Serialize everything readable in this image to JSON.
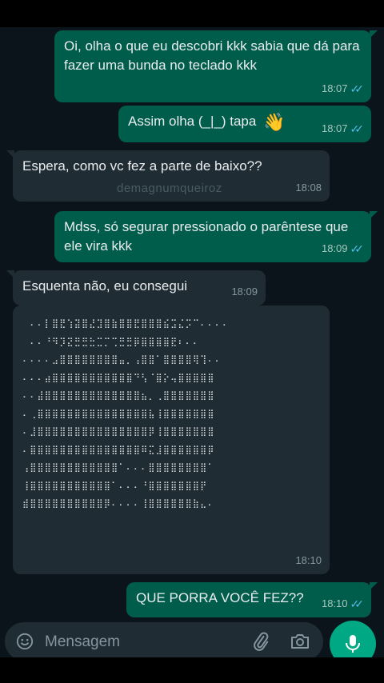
{
  "messages": [
    {
      "id": "m1",
      "direction": "out",
      "text": "Oi, olha o que eu descobri kkk sabia que dá para fazer uma bunda no teclado kkk",
      "time": "18:07",
      "status": "read"
    },
    {
      "id": "m2",
      "direction": "out",
      "text": "Assim olha (_|_) tapa",
      "emoji": "👋",
      "time": "18:07",
      "status": "read"
    },
    {
      "id": "m3",
      "direction": "in",
      "text": "Espera, como vc fez a parte de baixo??",
      "time": "18:08",
      "watermark": "demagnumqueiroz"
    },
    {
      "id": "m4",
      "direction": "out",
      "text": "Mdss, só segurar pressionado o parêntese que ele vira kkk",
      "time": "18:09",
      "status": "read"
    },
    {
      "id": "m5",
      "direction": "in",
      "text": "Esquenta não, eu consegui",
      "time": "18:09"
    },
    {
      "id": "m6",
      "direction": "in",
      "type": "braille-art",
      "lines": [
        "⠀⠄⠄⡇⣿⣟⢱⣽⣿⣜⣹⣿⣷⣿⣿⣟⣿⣿⣿⣮⣩⣌⡩⠉⠄⠄⠄⠄",
        "⠀⠄⠄⠘⠻⡹⣝⣛⣛⣓⣉⡉⢉⣛⣛⡿⣿⣿⣿⣿⣟⠆⠄⠄",
        "⠄⠄⠄⠄⣠⣿⣿⣿⣿⣿⣿⣿⣿⣤⡀⢠⣿⣿⠁⣿⣿⣿⣿⢿⢹⠄⠄",
        "⠄⠄⠄⣴⣿⣿⣿⣿⣿⣿⣿⣿⣿⣿⣿⠙⢣⠈⣿⡕⢤⣿⣿⣿⣿⣿",
        "⠄⠄⣼⣿⣿⣿⣿⣿⣿⣿⣿⣿⣿⣿⣿⣿⣦⡀⢀⣿⣿⣿⣿⣿⣿⣿",
        "⠄⢀⣿⣿⣿⣿⣿⣿⣿⣿⣿⣿⣿⣿⣿⣿⣿⣧⢸⣿⣿⣿⣿⣿⣿⣿",
        "⠄⣸⣿⣿⣿⣿⣿⣿⣿⣿⣿⣿⣿⣿⣿⣿⣿⡿⢸⣿⣿⣿⣿⣿⣿⣿",
        "⠄⣿⣿⣿⣿⣿⣿⣿⣿⣿⣿⣿⣿⣿⣿⣿⠿⣍⣸⣿⣿⣿⣿⣿⣿⡿",
        "⢠⣿⣿⣿⣿⣿⣿⣿⣿⣿⣿⣿⣿⠁⠄⠄⠄⣿⣿⣿⣿⣿⣿⣿⣿⠁",
        "⢸⣿⣿⣿⣿⣿⣿⣿⣿⣿⣿⣿⠁⠄⠄⠄⠘⣿⣿⣿⣿⣿⣿⣿⡟",
        "⣾⣿⣿⣿⣿⣿⣿⣿⣿⣿⣿⡿⠄⠄⠄⠄⢸⣿⣿⣿⣿⣿⣿⣷⣄⠄"
      ],
      "time": "18:10"
    },
    {
      "id": "m7",
      "direction": "out",
      "text": "QUE PORRA VOCÊ FEZ??",
      "time": "18:10",
      "status": "read"
    }
  ],
  "composer": {
    "placeholder": "Mensagem"
  },
  "icons": {
    "emoji": "smiley-icon",
    "attach": "paperclip-icon",
    "camera": "camera-icon",
    "mic": "microphone-icon",
    "read_receipt": "double-check-icon"
  },
  "colors": {
    "background": "#0b141a",
    "outgoing": "#005c4b",
    "incoming": "#202c33",
    "accent": "#00a884",
    "read_tick": "#53bdeb"
  }
}
